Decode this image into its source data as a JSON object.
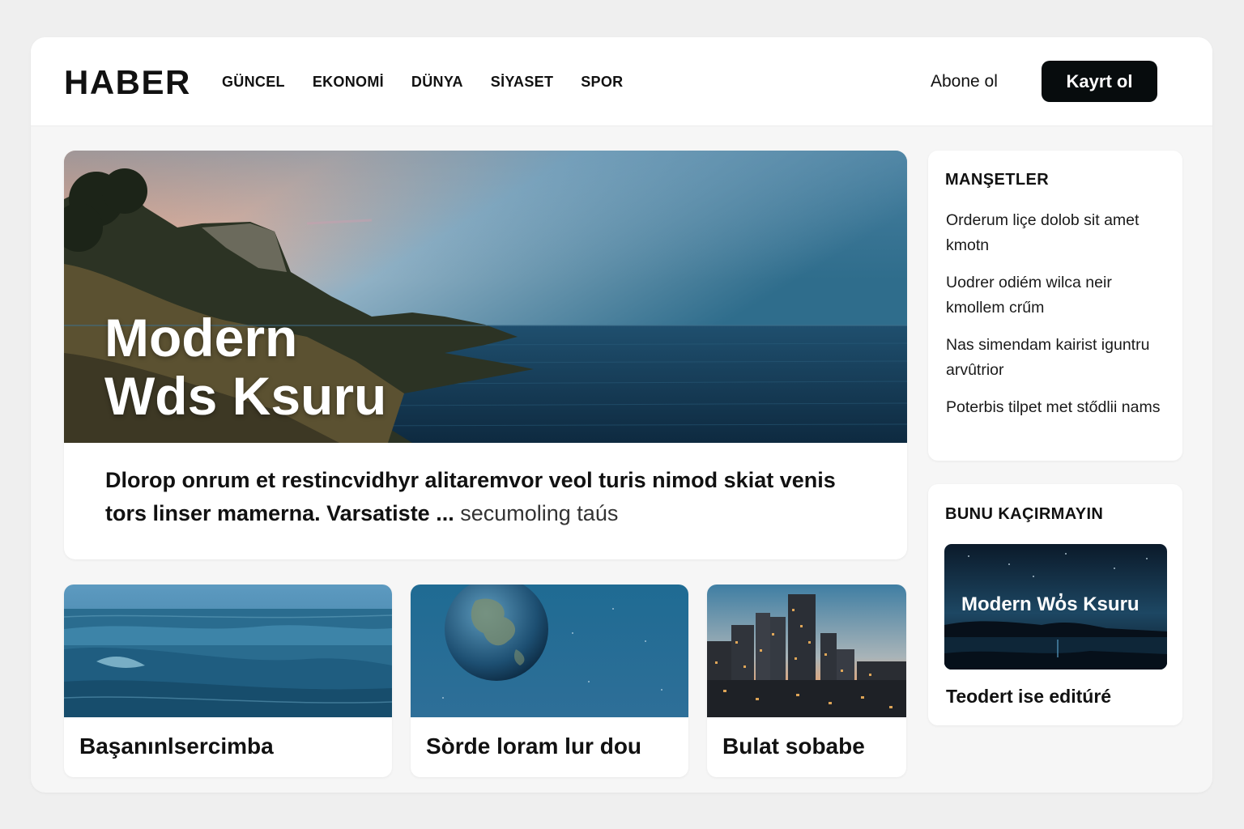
{
  "header": {
    "logo": "HABER",
    "nav": [
      "GÜNCEL",
      "EKONOMİ",
      "DÜNYA",
      "SİYASET",
      "SPOR"
    ],
    "subscribe_label": "Abone ol",
    "register_label": "Kayrt ol"
  },
  "hero": {
    "title_line1": "Modern",
    "title_line2": "Wds Ksuru",
    "excerpt": "Dlorop onrum et restincvidhyr alitaremvor veol turis nimod skiat venis tors linser mamerna. Varsatiste ...",
    "more_link": "secumoling taús"
  },
  "cards": [
    {
      "title": "Başanınlsercimba"
    },
    {
      "title": "Sòrde loram lur dou"
    },
    {
      "title": "Bulat sobabe"
    }
  ],
  "sidebar": {
    "headlines_heading": "MANŞETLER",
    "headlines": [
      "Orderum liçe dolob sit amet kmotn",
      "Uodrer odiém  wilca neir kmollem crűm",
      "Nas simendam kairist iguntru arvûtrior",
      "Poterbis tilpet met stődlii nams"
    ],
    "promo_heading": "BUNU KAÇIRMAYIN",
    "promo_image_title": "Modern Wo̓s Ksuru",
    "promo_caption": "Teodert ise editúré"
  },
  "colors": {
    "accent_button": "#070c0d",
    "page_background": "#efefef",
    "card_background": "#ffffff"
  }
}
